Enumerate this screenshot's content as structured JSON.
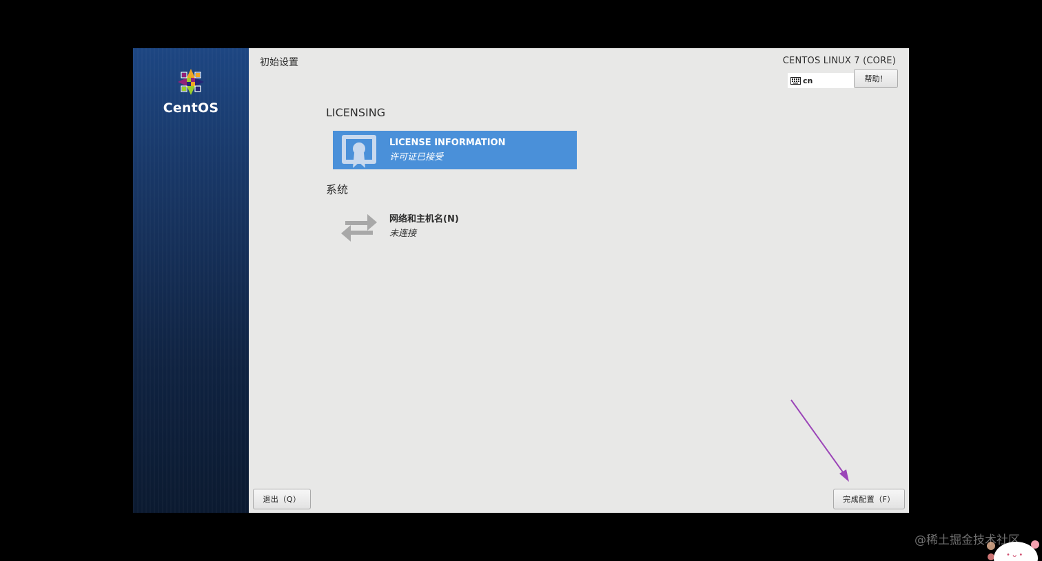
{
  "sidebar": {
    "logo_text": "CentOS"
  },
  "header": {
    "title": "初始设置",
    "product": "CENTOS LINUX 7 (CORE)",
    "keyboard_layout": "cn",
    "help_label": "帮助！"
  },
  "sections": [
    {
      "title": "LICENSING",
      "spokes": [
        {
          "title": "LICENSE INFORMATION",
          "status": "许可证已接受",
          "icon": "license-certificate-icon"
        }
      ]
    },
    {
      "title": "系统",
      "spokes": [
        {
          "title": "网络和主机名(N)",
          "status": "未连接",
          "icon": "network-arrows-icon"
        }
      ]
    }
  ],
  "footer": {
    "quit_label": "退出（Q）",
    "finish_label": "完成配置（F）"
  },
  "watermark": "@稀土掘金技术社区",
  "colors": {
    "accent": "#4a90d9",
    "background": "#e8e8e7",
    "sidebar_top": "#1d4682",
    "annotation_arrow": "#9b45b8"
  }
}
